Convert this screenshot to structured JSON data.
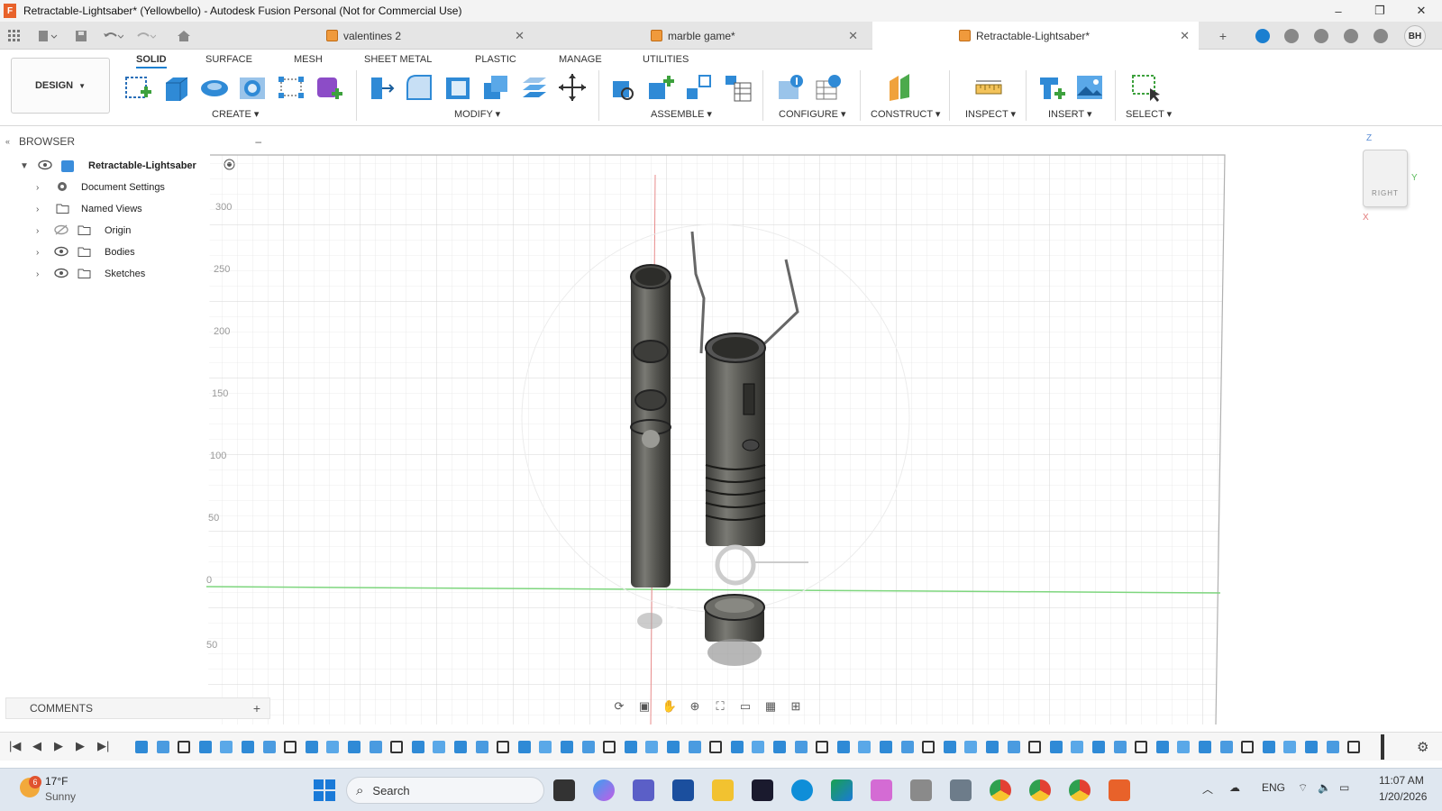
{
  "window": {
    "title": "Retractable-Lightsaber* (Yellowbello) - Autodesk Fusion Personal (Not for Commercial Use)",
    "app_logo": "F",
    "controls": [
      "–",
      "❐",
      "✕"
    ]
  },
  "doc_tabs": [
    {
      "label": "valentines 2",
      "active": false
    },
    {
      "label": "marble game*",
      "active": false
    },
    {
      "label": "Retractable-Lightsaber*",
      "active": true
    }
  ],
  "user": {
    "initials": "BH"
  },
  "toolbar": {
    "workspace": "DESIGN",
    "tabs": [
      "SOLID",
      "SURFACE",
      "MESH",
      "SHEET METAL",
      "PLASTIC",
      "MANAGE",
      "UTILITIES"
    ],
    "groups": [
      "CREATE",
      "MODIFY",
      "ASSEMBLE",
      "CONFIGURE",
      "CONSTRUCT",
      "INSPECT",
      "INSERT",
      "SELECT"
    ]
  },
  "browser": {
    "title": "BROWSER",
    "root": "Retractable-Lightsaber",
    "items": [
      "Document Settings",
      "Named Views",
      "Origin",
      "Bodies",
      "Sketches"
    ]
  },
  "comments": {
    "title": "COMMENTS",
    "add": "+"
  },
  "viewport": {
    "axis_labels": [
      "300",
      "250",
      "200",
      "150",
      "100",
      "50",
      "0",
      "50"
    ],
    "view_cube": "RIGHT",
    "axis_z": "Z",
    "axis_y": "Y",
    "axis_x": "X"
  },
  "taskbar": {
    "temperature": "17°F",
    "weather": "Sunny",
    "weather_badge": "6",
    "search_placeholder": "Search",
    "language": "ENG",
    "time": "11:07 AM",
    "date": "1/20/2026"
  },
  "colors": {
    "accent": "#1b7fd0",
    "fusion_orange": "#e8622a",
    "grid": "#d9d9d9",
    "y_axis": "#7ed67e",
    "z_axis": "#e88b8b"
  }
}
